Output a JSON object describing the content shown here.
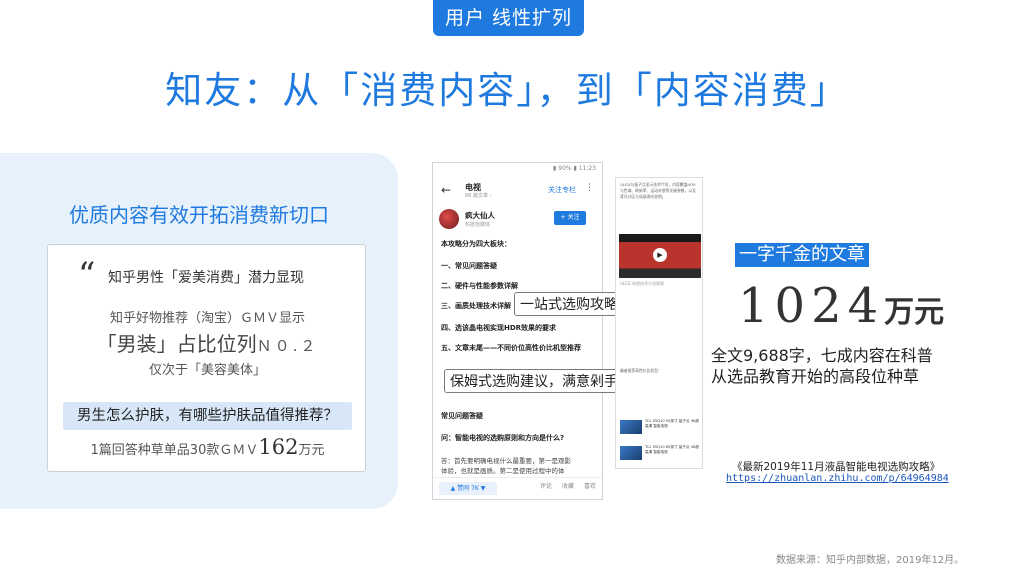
{
  "badge": "用户 线性扩列",
  "main_title": "知友：从「消费内容」，到「内容消费」",
  "left": {
    "title": "优质内容有效开拓消费新切口",
    "quote_mark": "“",
    "quote_headline": "知乎男性「爱美消费」潜力显现",
    "stat1": "知乎好物推荐（淘宝）ＧＭＶ显示",
    "stat2_main": "「男装」占比位列",
    "stat2_rank": "Ｎ０.２",
    "stat3": "仅次于「美容美体」",
    "question": "男生怎么护肤，有哪些护肤品值得推荐？",
    "stat4_prefix": "1篇回答种草单品30款ＧＭＶ",
    "stat4_num": "162",
    "stat4_unit": "万元"
  },
  "phone": {
    "status": "▮ 90% ▮ 11:23",
    "back": "←",
    "nav_title": "电视",
    "nav_sub": "88 篇文章 ›",
    "follow_column": "关注专栏",
    "more": "⋮",
    "author_name": "疯大仙人",
    "author_desc": "科技自媒体",
    "follow_btn": "+ 关注",
    "lines": [
      "本攻略分为四大板块：",
      "一、常见问题答疑",
      "二、硬件与性能参数详解",
      "三、画质处理技术详解",
      "四、选该晶电视实现HDR效果的要求",
      "五、文章末尾——不同价位高性价比机型推荐",
      "常见问题答疑",
      "问：智能电视的选购原则和方向是什么?",
      "答：首先要明确电视什么最重要，第一是观影",
      "体验，也就是画质。第二是使用过程中的体"
    ],
    "vote": "▲ 赞同 7K  ▼",
    "bottom_icons": [
      "评论",
      "收藏",
      "喜欢"
    ]
  },
  "callouts": {
    "c1": "一站式选购攻略，安心入坑",
    "c2": "保姆式选购建议，满意剁手"
  },
  "article": {
    "para1": "QLED与量子点显示技术介绍，内容覆盖HDR与色域、刷新率、运动补偿等关键参数，以及背光分区与局部调光说明。",
    "play": "▶",
    "caption": "ULED 电视技术介绍视频",
    "para2": "编者推荐高性价比机型：",
    "products": [
      "TCL 55Q10 55英寸 量子点 4K超高清 智能电视",
      "TCL 55Q10 65英寸 量子点 4K超高清 智能电视"
    ]
  },
  "right": {
    "banner": "一字千金的文章",
    "count": "1024",
    "count_unit": "万元",
    "summary_line1": "全文9,688字，七成内容在科普",
    "summary_line2": "从选品教育开始的高段位种草",
    "ref_title": "《最新2019年11月液晶智能电视选购攻略》",
    "ref_link": "https://zhuanlan.zhihu.com/p/64964984"
  },
  "source": "数据来源：知乎内部数据，2019年12月。"
}
